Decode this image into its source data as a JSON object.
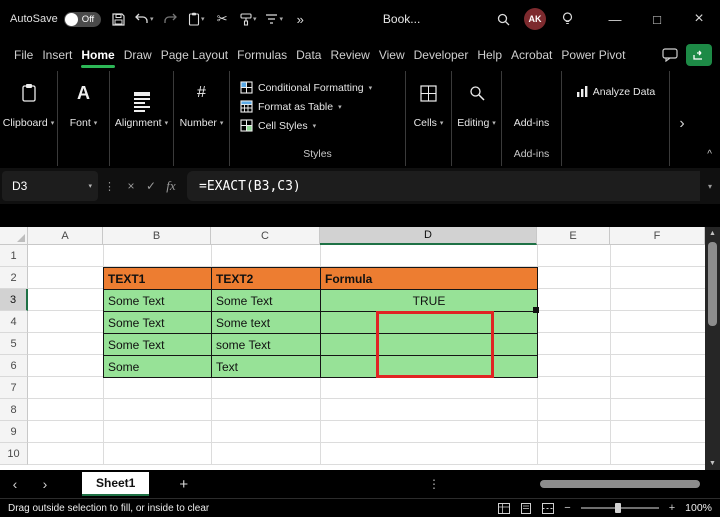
{
  "titlebar": {
    "autosave_label": "AutoSave",
    "autosave_state": "Off",
    "title": "Book...",
    "avatar_initials": "AK"
  },
  "menubar": {
    "items": [
      "File",
      "Insert",
      "Home",
      "Draw",
      "Page Layout",
      "Formulas",
      "Data",
      "Review",
      "View",
      "Developer",
      "Help",
      "Acrobat",
      "Power Pivot"
    ],
    "active_item": "Home"
  },
  "ribbon": {
    "clipboard_label": "Clipboard",
    "font_label": "Font",
    "alignment_label": "Alignment",
    "number_label": "Number",
    "styles_buttons": [
      "Conditional Formatting",
      "Format as Table",
      "Cell Styles"
    ],
    "styles_group_label": "Styles",
    "cells_label": "Cells",
    "editing_label": "Editing",
    "addins_button_label": "Add-ins",
    "addins_group_label": "Add-ins",
    "analyze_data_label": "Analyze Data"
  },
  "formula_bar": {
    "name_box": "D3",
    "fx_label": "fx",
    "formula": "=EXACT(B3,C3)"
  },
  "grid": {
    "col_headers": [
      "A",
      "B",
      "C",
      "D",
      "E",
      "F"
    ],
    "selected_column": "D",
    "row_headers": [
      "1",
      "2",
      "3",
      "4",
      "5",
      "6",
      "7",
      "8",
      "9",
      "10"
    ],
    "selected_row": "3",
    "table": {
      "headers": {
        "col1": "TEXT1",
        "col2": "TEXT2",
        "col3": "Formula"
      },
      "rows": [
        {
          "col1": "Some Text",
          "col2": "Some Text",
          "col3": "TRUE"
        },
        {
          "col1": "Some Text",
          "col2": "Some text",
          "col3": ""
        },
        {
          "col1": "Some Text",
          "col2": "some Text",
          "col3": ""
        },
        {
          "col1": "Some",
          "col2": "Text",
          "col3": ""
        }
      ]
    }
  },
  "sheet_tabs": {
    "active_tab": "Sheet1"
  },
  "status_bar": {
    "hint": "Drag outside selection to fill, or inside to clear",
    "zoom": "100%"
  },
  "colors": {
    "accent_green": "#1E7145",
    "menu_underline_green": "#2DB757",
    "table_header_orange": "#ED7D31",
    "cell_fill_green": "#97E297",
    "annotation_red": "#E02424",
    "addins_red": "#E8401F",
    "avatar_maroon": "#7d2a2e"
  }
}
